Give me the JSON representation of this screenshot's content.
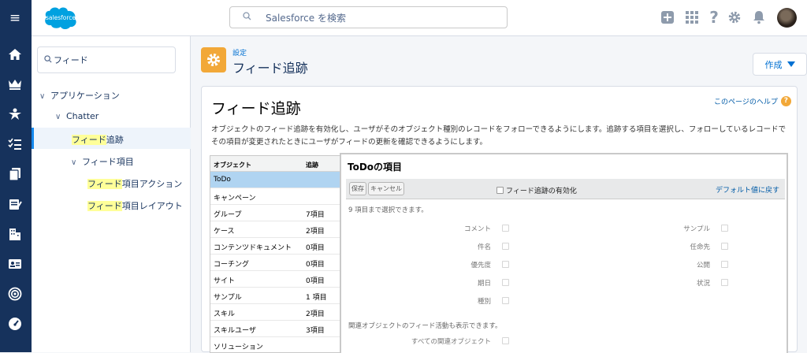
{
  "header": {
    "logo_text": "salesforce",
    "search_placeholder": "Salesforce を検索"
  },
  "left_nav_icons": [
    "menu-icon",
    "home-icon",
    "crown-icon",
    "star-icon",
    "list-icon",
    "files-icon",
    "sign-icon",
    "building-icon",
    "contact-card-icon",
    "target-icon",
    "gauge-icon"
  ],
  "setup_nav": {
    "quick_find_value": "フィード",
    "tree": {
      "applications": "アプリケーション",
      "chatter": "Chatter",
      "feed_tracking_hl": "フィード",
      "feed_tracking_rest": "追跡",
      "feed_items": "フィード項目",
      "feed_item_actions_hl": "フィード",
      "feed_item_actions_rest": "項目アクション",
      "feed_item_layouts_hl": "フィード",
      "feed_item_layouts_rest": "項目レイアウト"
    }
  },
  "page": {
    "breadcrumb": "設定",
    "title": "フィード追跡",
    "create_button": "作成"
  },
  "card": {
    "title": "フィード追跡",
    "help_link": "このページのヘルプ",
    "description": "オブジェクトのフィード追跡を有効化し、ユーザがそのオブジェクト種別のレコードをフォローできるようにします。追跡する項目を選択し、フォローしているレコードでその項目が変更されたときにユーザがフィードの更新を確認できるようにします。"
  },
  "object_table": {
    "col_object": "オブジェクト",
    "col_tracked": "追跡",
    "rows": [
      {
        "name": "ToDo",
        "tracked": ""
      },
      {
        "name": "キャンペーン",
        "tracked": ""
      },
      {
        "name": "グループ",
        "tracked": "7項目"
      },
      {
        "name": "ケース",
        "tracked": "2項目"
      },
      {
        "name": "コンテンツドキュメント",
        "tracked": "0項目"
      },
      {
        "name": "コーチング",
        "tracked": "0項目"
      },
      {
        "name": "サイト",
        "tracked": "0項目"
      },
      {
        "name": "サンプル",
        "tracked": "1 項目"
      },
      {
        "name": "スキル",
        "tracked": "2項目"
      },
      {
        "name": "スキルユーザ",
        "tracked": "3項目"
      },
      {
        "name": "ソリューション",
        "tracked": ""
      }
    ]
  },
  "fields_panel": {
    "title": "ToDoの項目",
    "save_button": "保存",
    "cancel_button": "キャンセル",
    "enable_label": "フィード追跡の有効化",
    "defaults_link": "デフォルト値に戻す",
    "select_note": "9 項目まで選択できます。",
    "left_fields": [
      "コメント",
      "件名",
      "優先度",
      "期日",
      "種別"
    ],
    "right_fields": [
      "サンプル",
      "任命先",
      "公開",
      "状況"
    ],
    "related_note": "関連オブジェクトのフィード活動も表示できます。",
    "all_related_label": "すべての関連オブジェクト"
  },
  "colors": {
    "nav_bg": "#16325c",
    "accent": "#0070d2",
    "page_icon": "#f2a838",
    "selected_row": "#b0d4f1",
    "highlight": "#ffff99"
  }
}
